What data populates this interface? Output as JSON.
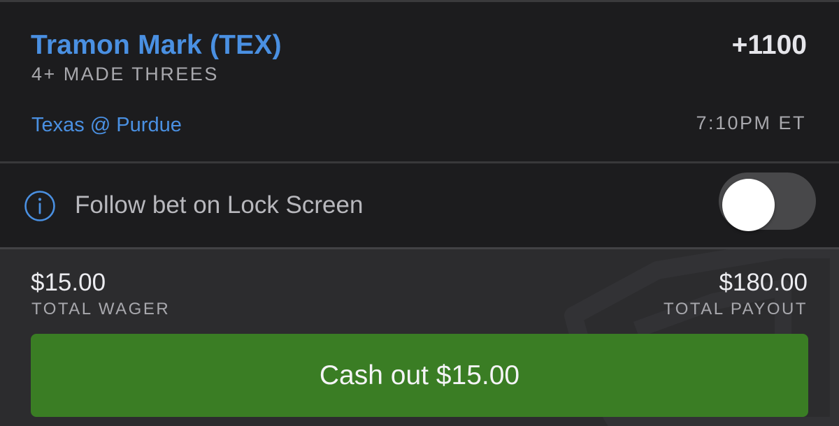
{
  "bet": {
    "player_name": "Tramon Mark (TEX)",
    "odds": "+1100",
    "market": "4+ MADE THREES",
    "matchup": "Texas @ Purdue",
    "game_time": "7:10PM ET"
  },
  "lock_screen": {
    "label": "Follow bet on Lock Screen",
    "toggle_on": false
  },
  "summary": {
    "wager_amount": "$15.00",
    "wager_label": "TOTAL WAGER",
    "payout_amount": "$180.00",
    "payout_label": "TOTAL PAYOUT"
  },
  "cashout": {
    "label": "Cash out $15.00"
  },
  "icons": {
    "info": "info-circle-icon",
    "watermark": "brand-shield-watermark"
  },
  "colors": {
    "accent_blue": "#4a90e2",
    "button_green": "#3a7d24",
    "background": "#1c1c1e",
    "summary_background": "#2c2c2e"
  }
}
